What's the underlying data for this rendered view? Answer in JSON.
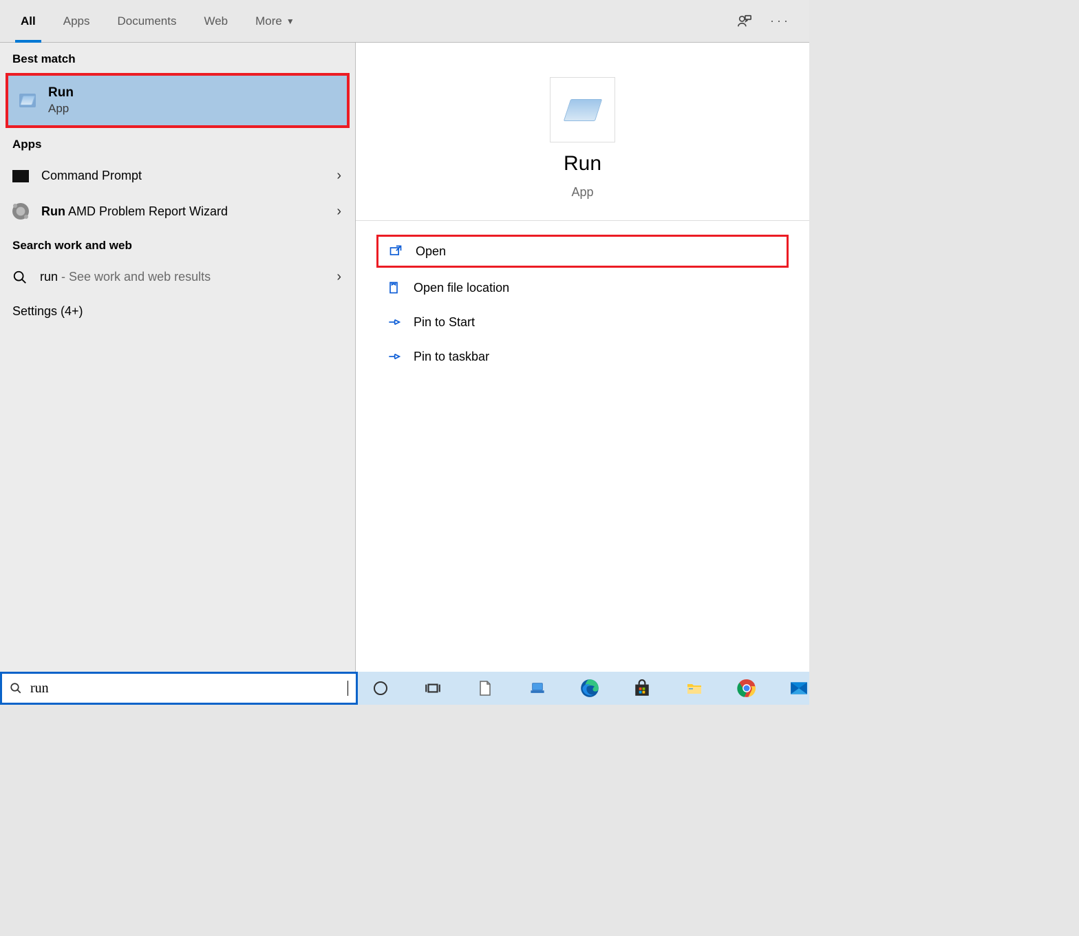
{
  "tabs": {
    "all": "All",
    "apps": "Apps",
    "documents": "Documents",
    "web": "Web",
    "more": "More"
  },
  "left": {
    "best_match_header": "Best match",
    "best": {
      "title": "Run",
      "subtitle": "App"
    },
    "apps_header": "Apps",
    "app1": "Command Prompt",
    "app2_bold": "Run",
    "app2_rest": " AMD Problem Report Wizard",
    "search_web_header": "Search work and web",
    "web_query": "run",
    "web_hint": " - See work and web results",
    "settings": "Settings (4+)"
  },
  "preview": {
    "title": "Run",
    "subtitle": "App",
    "open": "Open",
    "open_loc": "Open file location",
    "pin_start": "Pin to Start",
    "pin_task": "Pin to taskbar"
  },
  "taskbar": {
    "search_value": "run"
  }
}
